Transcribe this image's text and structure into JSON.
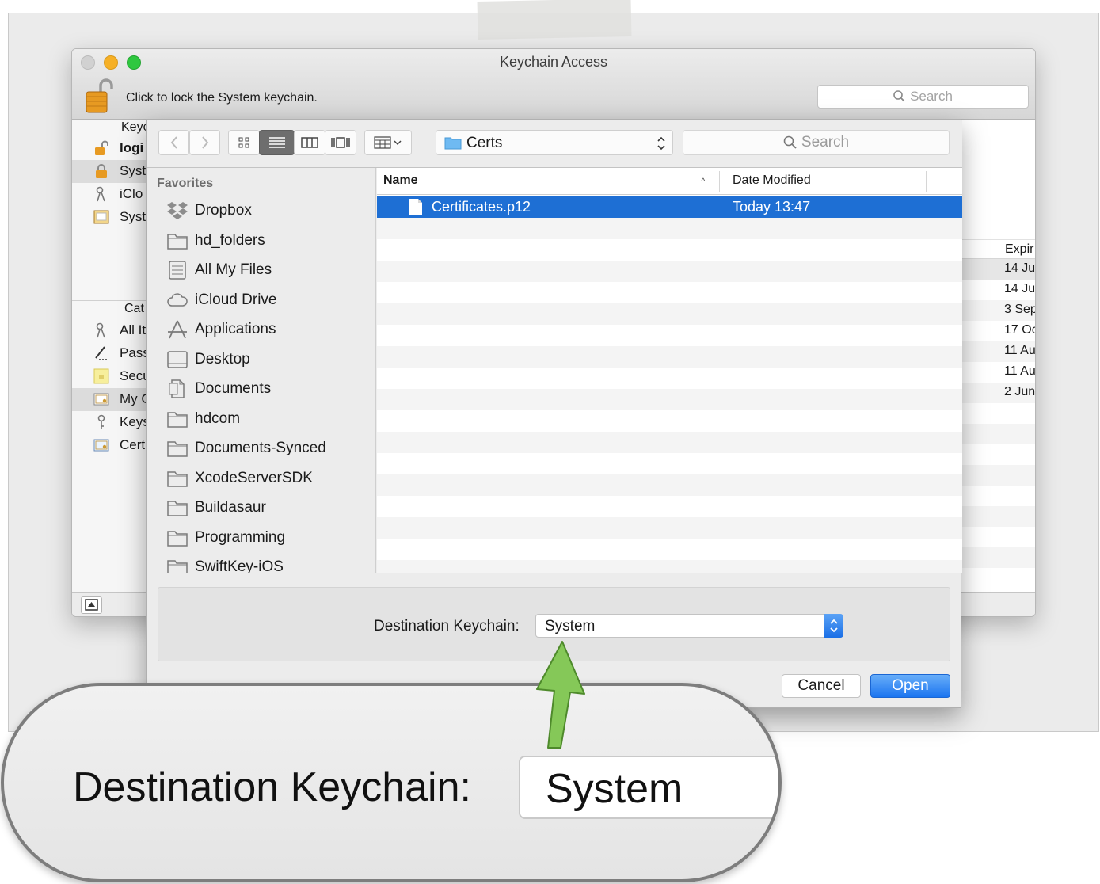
{
  "window": {
    "title": "Keychain Access",
    "lock_text": "Click to lock the System keychain.",
    "search_placeholder": "Search"
  },
  "keychains": {
    "header": "Keyc",
    "items": [
      {
        "label": "logi",
        "icon": "lock-open-icon",
        "bold": true
      },
      {
        "label": "Syst",
        "icon": "lock-icon",
        "selected": true
      },
      {
        "label": "iClo",
        "icon": "keys-icon"
      },
      {
        "label": "Syst",
        "icon": "certificate-cabinet-icon"
      }
    ]
  },
  "categories": {
    "header": "Cat",
    "items": [
      {
        "label": "All It",
        "icon": "keys-icon"
      },
      {
        "label": "Pass",
        "icon": "pen-icon"
      },
      {
        "label": "Secu",
        "icon": "secure-note-icon"
      },
      {
        "label": "My C",
        "icon": "certificate-icon",
        "selected": true
      },
      {
        "label": "Keys",
        "icon": "key-icon"
      },
      {
        "label": "Cert",
        "icon": "certificate-icon"
      }
    ]
  },
  "expiry": {
    "header": "Expir",
    "values": [
      "14 Ju",
      "14 Ju",
      "3 Sep",
      "17 Oc",
      "11 Au",
      "11 Au",
      "2 Jun"
    ]
  },
  "sheet": {
    "path": "Certs",
    "search_placeholder": "Search",
    "favorites_header": "Favorites",
    "favorites": [
      {
        "label": "Dropbox",
        "icon": "dropbox-icon"
      },
      {
        "label": "hd_folders",
        "icon": "folder-icon"
      },
      {
        "label": "All My Files",
        "icon": "all-my-files-icon"
      },
      {
        "label": "iCloud Drive",
        "icon": "cloud-icon"
      },
      {
        "label": "Applications",
        "icon": "applications-icon"
      },
      {
        "label": "Desktop",
        "icon": "desktop-icon"
      },
      {
        "label": "Documents",
        "icon": "documents-icon"
      },
      {
        "label": "hdcom",
        "icon": "folder-icon"
      },
      {
        "label": "Documents-Synced",
        "icon": "folder-icon"
      },
      {
        "label": "XcodeServerSDK",
        "icon": "folder-icon"
      },
      {
        "label": "Buildasaur",
        "icon": "folder-icon"
      },
      {
        "label": "Programming",
        "icon": "folder-icon"
      },
      {
        "label": "SwiftKey-iOS",
        "icon": "folder-icon"
      }
    ],
    "columns": {
      "name": "Name",
      "date": "Date Modified"
    },
    "files": [
      {
        "name": "Certificates.p12",
        "date": "Today 13:47",
        "selected": true
      }
    ],
    "destination_label": "Destination Keychain:",
    "destination_value": "System",
    "cancel_label": "Cancel",
    "open_label": "Open"
  },
  "callout": {
    "label": "Destination Keychain:",
    "value": "System"
  },
  "colors": {
    "selection": "#1e6fd4",
    "primary_button": "#1b75f0",
    "arrow": "#7cc04a"
  }
}
